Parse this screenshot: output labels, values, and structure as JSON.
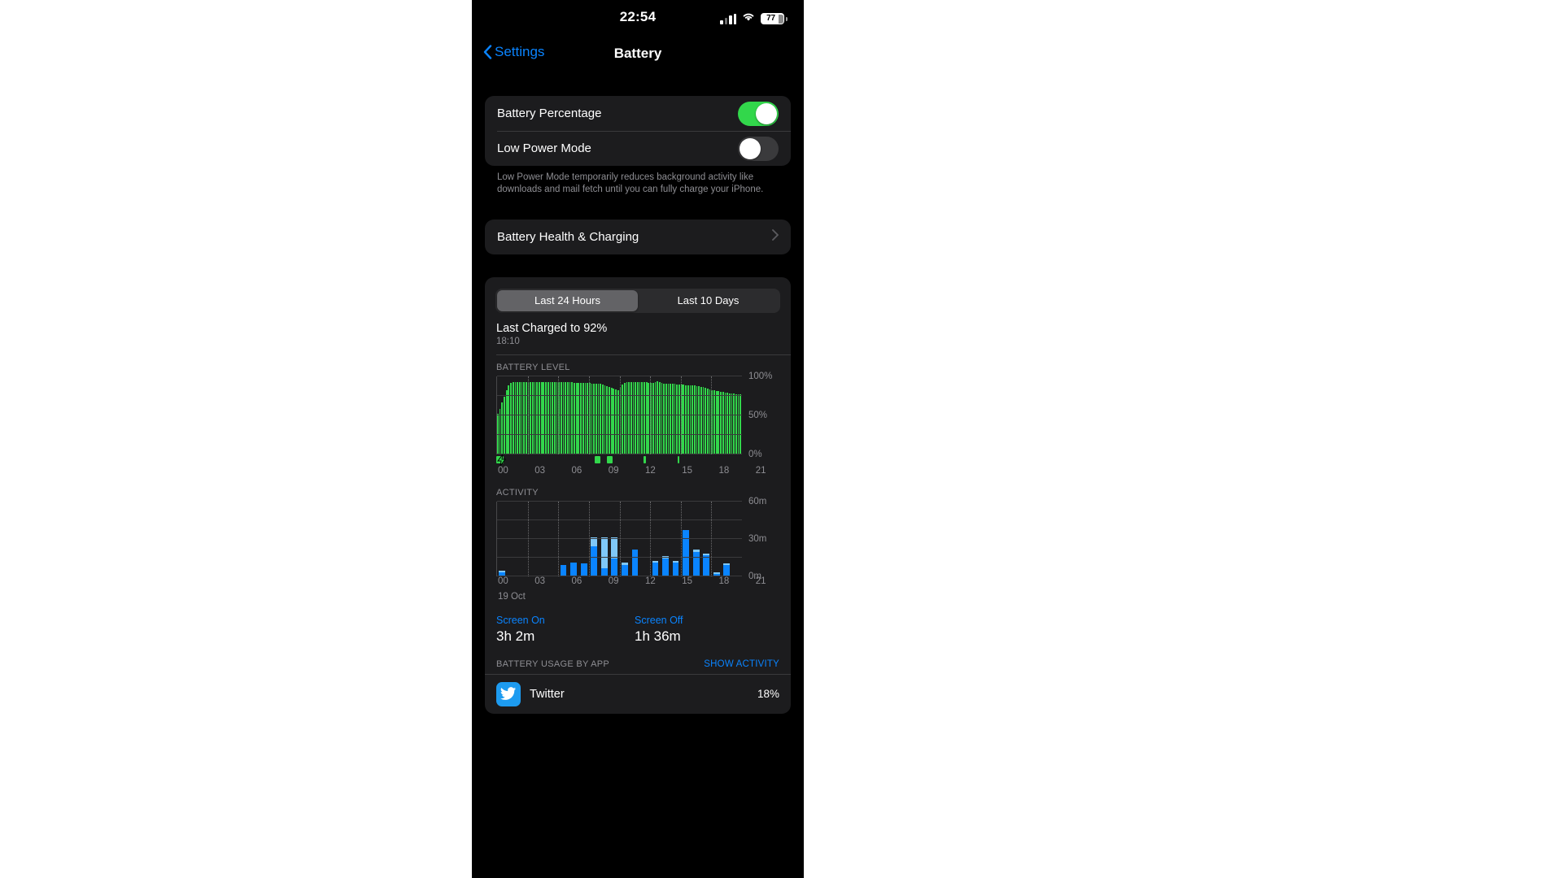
{
  "status_bar": {
    "time": "22:54",
    "battery_percent_label": "77",
    "signal_icon": "cellular-signal-icon",
    "wifi_icon": "wifi-icon",
    "battery_icon": "battery-icon"
  },
  "nav": {
    "back_label": "Settings",
    "title": "Battery",
    "back_icon": "chevron-left-icon"
  },
  "settings_group": {
    "battery_percentage": {
      "label": "Battery Percentage",
      "state": "on"
    },
    "low_power_mode": {
      "label": "Low Power Mode",
      "state": "off"
    },
    "footnote": "Low Power Mode temporarily reduces background activity like downloads and mail fetch until you can fully charge your iPhone."
  },
  "health_row": {
    "label": "Battery Health & Charging",
    "disclosure_icon": "chevron-right-icon"
  },
  "usage_card": {
    "segments": [
      {
        "label": "Last 24 Hours",
        "selected": true
      },
      {
        "label": "Last 10 Days",
        "selected": false
      }
    ],
    "last_charged_title": "Last Charged to 92%",
    "last_charged_time": "18:10",
    "battery_level_label": "BATTERY LEVEL",
    "activity_label": "ACTIVITY",
    "date_label": "19 Oct",
    "screen_on": {
      "label": "Screen On",
      "value": "3h 2m"
    },
    "screen_off": {
      "label": "Screen Off",
      "value": "1h 36m"
    },
    "usage_by_app_label": "BATTERY USAGE BY APP",
    "show_activity_label": "SHOW ACTIVITY",
    "apps": [
      {
        "name": "Twitter",
        "percent": "18%",
        "bar_fraction": 1.0,
        "icon": "twitter-icon",
        "icon_color": "#1d9bf0"
      }
    ]
  },
  "colors": {
    "accent_blue": "#0a84ff",
    "battery_green": "#32d74b",
    "screen_on_blue": "#0a84ff",
    "screen_off_blue": "#7fc8f8",
    "card_bg": "#1c1c1e",
    "page_bg": "#000000"
  },
  "chart_data": [
    {
      "type": "area",
      "title": "BATTERY LEVEL",
      "xlabel": "",
      "ylabel": "",
      "ylim": [
        0,
        100
      ],
      "yticks": [
        0,
        50,
        100
      ],
      "ytick_labels": [
        "0%",
        "50%",
        "100%"
      ],
      "xticks": [
        0,
        3,
        6,
        9,
        12,
        15,
        18,
        21
      ],
      "xtick_labels": [
        "00",
        "03",
        "06",
        "09",
        "12",
        "15",
        "18",
        "21"
      ],
      "grid": true,
      "series_color": "#32d74b",
      "values": [
        52,
        58,
        66,
        74,
        82,
        88,
        91,
        92,
        92,
        92,
        92,
        92,
        92,
        92,
        92,
        92,
        92,
        92,
        92,
        92,
        92,
        92,
        92,
        92,
        92,
        92,
        92,
        92,
        92,
        92,
        92,
        92,
        92,
        92,
        92,
        91,
        91,
        91,
        91,
        91,
        91,
        91,
        91,
        90,
        90,
        90,
        90,
        90,
        89,
        88,
        87,
        86,
        85,
        84,
        83,
        82,
        86,
        89,
        91,
        92,
        92,
        92,
        92,
        92,
        92,
        92,
        92,
        92,
        92,
        91,
        91,
        91,
        92,
        93,
        92,
        91,
        90,
        90,
        90,
        90,
        90,
        90,
        89,
        89,
        89,
        89,
        88,
        88,
        88,
        88,
        88,
        87,
        87,
        86,
        86,
        85,
        84,
        83,
        82,
        82,
        81,
        81,
        80,
        80,
        79,
        79,
        78,
        78,
        78,
        77,
        77,
        77
      ],
      "charge_markers": [
        {
          "start_hour": 0.0,
          "end_hour": 0.75,
          "bolt": true
        },
        {
          "start_hour": 9.6,
          "end_hour": 10.2,
          "bolt": false
        },
        {
          "start_hour": 10.8,
          "end_hour": 11.4,
          "bolt": false
        },
        {
          "start_hour": 14.4,
          "end_hour": 14.6,
          "bolt": false
        },
        {
          "start_hour": 17.7,
          "end_hour": 17.9,
          "bolt": false
        }
      ]
    },
    {
      "type": "bar",
      "title": "ACTIVITY",
      "xlabel": "",
      "ylabel": "",
      "ylim": [
        0,
        60
      ],
      "yticks": [
        0,
        30,
        60
      ],
      "ytick_labels": [
        "0m",
        "30m",
        "60m"
      ],
      "xticks": [
        0,
        3,
        6,
        9,
        12,
        15,
        18,
        21
      ],
      "xtick_labels": [
        "00",
        "03",
        "06",
        "09",
        "12",
        "15",
        "18",
        "21"
      ],
      "grid": true,
      "categories": [
        "00",
        "01",
        "02",
        "03",
        "04",
        "05",
        "06",
        "07",
        "08",
        "09",
        "10",
        "11",
        "12",
        "13",
        "14",
        "15",
        "16",
        "17",
        "18",
        "19",
        "20",
        "21",
        "22",
        "23"
      ],
      "series": [
        {
          "name": "Screen On",
          "color": "#0a84ff",
          "values": [
            3,
            0,
            0,
            0,
            0,
            0,
            9,
            11,
            10,
            24,
            6,
            14,
            9,
            21,
            0,
            11,
            14,
            11,
            37,
            19,
            17,
            2,
            9,
            0
          ]
        },
        {
          "name": "Screen Off",
          "color": "#7fc8f8",
          "values": [
            1,
            0,
            0,
            0,
            0,
            0,
            0,
            0,
            0,
            7,
            25,
            17,
            2,
            0,
            0,
            1,
            2,
            1,
            0,
            2,
            1,
            1,
            1,
            0
          ]
        }
      ]
    }
  ]
}
